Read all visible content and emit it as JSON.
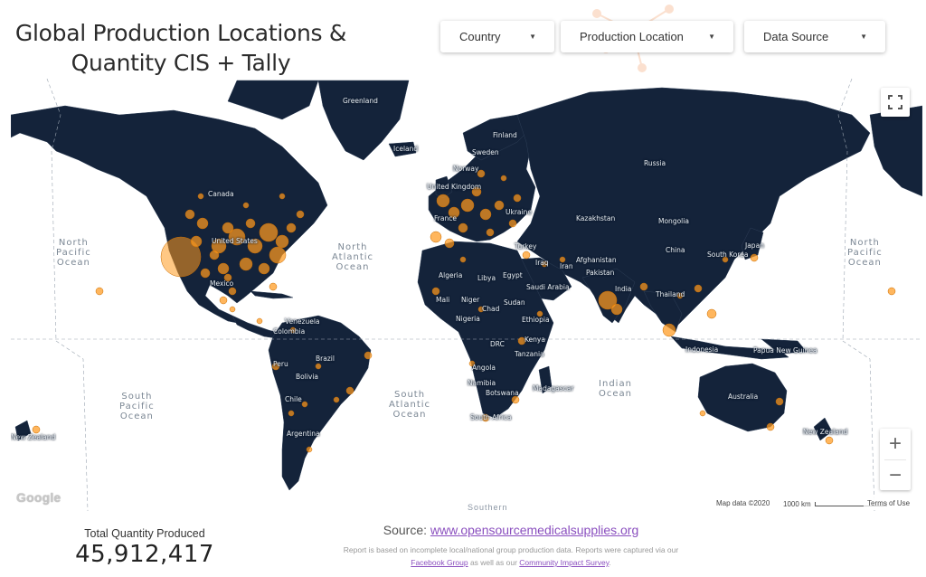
{
  "header": {
    "title_line1": "Global Production Locations &",
    "title_line2": "Quantity  CIS + Tally"
  },
  "filters": {
    "country_label": "Country",
    "location_label": "Production Location",
    "source_label": "Data Source"
  },
  "map": {
    "land_color": "#14233a",
    "marker_color": "#ff9a1f",
    "oceans": {
      "north_pacific_left": [
        "North",
        "Pacific",
        "Ocean"
      ],
      "north_atlantic": [
        "North",
        "Atlantic",
        "Ocean"
      ],
      "north_pacific_right": [
        "North",
        "Pacific",
        "Ocean"
      ],
      "south_pacific": [
        "South",
        "Pacific",
        "Ocean"
      ],
      "south_atlantic": [
        "South",
        "Atlantic",
        "Ocean"
      ],
      "indian": [
        "Indian",
        "Ocean"
      ],
      "southern": "Southern"
    },
    "countries": {
      "greenland": "Greenland",
      "iceland": "Iceland",
      "finland": "Finland",
      "sweden": "Sweden",
      "norway": "Norway",
      "uk": "United Kingdom",
      "france": "France",
      "ukraine": "Ukraine",
      "russia": "Russia",
      "canada": "Canada",
      "us": "United States",
      "mexico": "Mexico",
      "kazakhstan": "Kazakhstan",
      "mongolia": "Mongolia",
      "china": "China",
      "japan": "Japan",
      "south_korea": "South Korea",
      "turkey": "Turkey",
      "afghanistan": "Afghanistan",
      "iran": "Iran",
      "iraq": "Iraq",
      "pakistan": "Pakistan",
      "india": "India",
      "thailand": "Thailand",
      "algeria": "Algeria",
      "libya": "Libya",
      "egypt": "Egypt",
      "saudi": "Saudi Arabia",
      "mali": "Mali",
      "niger": "Niger",
      "chad": "Chad",
      "sudan": "Sudan",
      "nigeria": "Nigeria",
      "ethiopia": "Ethiopia",
      "drc": "DRC",
      "kenya": "Kenya",
      "tanzania": "Tanzania",
      "angola": "Angola",
      "namibia": "Namibia",
      "botswana": "Botswana",
      "madagascar": "Madagascar",
      "south_africa": "South Africa",
      "venezuela": "Venezuela",
      "colombia": "Colombia",
      "peru": "Peru",
      "brazil": "Brazil",
      "bolivia": "Bolivia",
      "chile": "Chile",
      "argentina": "Argentina",
      "indonesia": "Indonesia",
      "papua": "Papua New Guinea",
      "australia": "Australia",
      "new_zealand_left": "New Zealand",
      "new_zealand_right": "New Zealand"
    },
    "zoom_in": "+",
    "zoom_out": "−",
    "google": "Google",
    "map_data": "Map data ©2020",
    "scale": "1000 km",
    "terms": "Terms of Use"
  },
  "summary": {
    "total_label": "Total Quantity Produced",
    "total_value": "45,912,417"
  },
  "footer": {
    "source_prefix": "Source: ",
    "source_link": "www.opensourcemedicalsupplies.org",
    "note_line1": "Report is based on incomplete local/national group production data. Reports were captured via our",
    "note_link1": "Facebook Group",
    "note_mid": " as well as our ",
    "note_link2": "Community Impact Survey",
    "note_end": "."
  }
}
